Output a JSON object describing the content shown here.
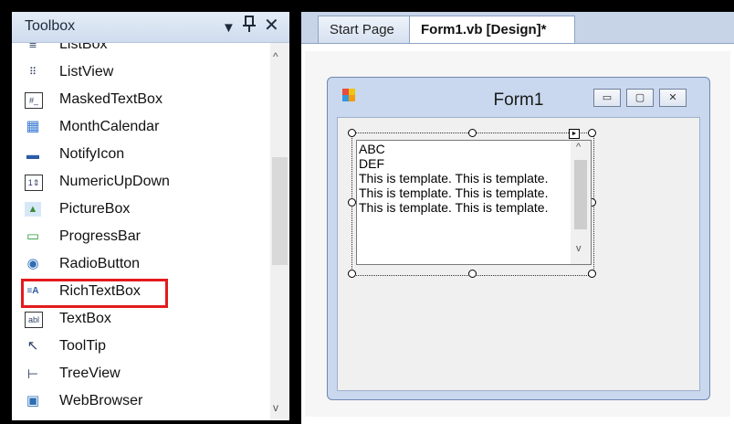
{
  "toolbox": {
    "title": "Toolbox",
    "pin_glyph": "ᚁ",
    "dropdown_glyph": "▼",
    "close_glyph": "✕",
    "items": [
      {
        "label": "ListBox",
        "icon": "listbox-icon",
        "glyph": "≣"
      },
      {
        "label": "ListView",
        "icon": "listview-icon",
        "glyph": "⠿"
      },
      {
        "label": "MaskedTextBox",
        "icon": "maskedtextbox-icon",
        "glyph": "#_"
      },
      {
        "label": "MonthCalendar",
        "icon": "monthcalendar-icon",
        "glyph": "▦"
      },
      {
        "label": "NotifyIcon",
        "icon": "notifyicon-icon",
        "glyph": "▬"
      },
      {
        "label": "NumericUpDown",
        "icon": "numericupdown-icon",
        "glyph": "1⇕"
      },
      {
        "label": "PictureBox",
        "icon": "picturebox-icon",
        "glyph": "▲"
      },
      {
        "label": "ProgressBar",
        "icon": "progressbar-icon",
        "glyph": "▭"
      },
      {
        "label": "RadioButton",
        "icon": "radiobutton-icon",
        "glyph": "◉"
      },
      {
        "label": "RichTextBox",
        "icon": "richtextbox-icon",
        "glyph": "≡A"
      },
      {
        "label": "TextBox",
        "icon": "textbox-icon",
        "glyph": "abl"
      },
      {
        "label": "ToolTip",
        "icon": "tooltip-icon",
        "glyph": "↖"
      },
      {
        "label": "TreeView",
        "icon": "treeview-icon",
        "glyph": "⊢"
      },
      {
        "label": "WebBrowser",
        "icon": "webbrowser-icon",
        "glyph": "▣"
      }
    ],
    "highlighted_item": "RichTextBox",
    "highlight_color": "#e41a1c"
  },
  "tabs": [
    {
      "label": "Start Page"
    },
    {
      "label": "Form1.vb [Design]*"
    }
  ],
  "form": {
    "title": "Form1",
    "min_glyph": "▭",
    "max_glyph": "▢",
    "close_glyph": "✕"
  },
  "richtextbox": {
    "lines": [
      "ABC",
      "DEF",
      "This is template. This is template. This is template. This is template. This is template. This is template."
    ]
  }
}
